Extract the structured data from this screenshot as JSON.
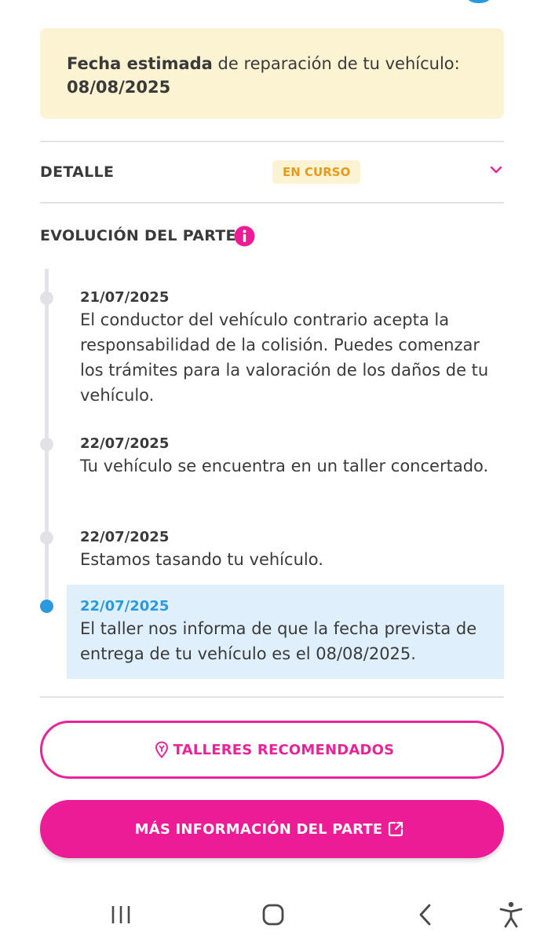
{
  "estimate": {
    "bold_label": "Fecha estimada",
    "label_rest": " de reparación de tu vehículo:",
    "date": "08/08/2025"
  },
  "detail": {
    "label": "DETALLE",
    "status": "EN CURSO"
  },
  "evolution": {
    "title": "EVOLUCIÓN DEL PARTE",
    "events": [
      {
        "date": "21/07/2025",
        "text": "El conductor del vehículo contrario acepta la responsabilidad de la colisión. Puedes comenzar los trámites para la valoración de los daños de tu vehículo."
      },
      {
        "date": "22/07/2025",
        "text": "Tu vehículo se encuentra en un taller concertado."
      },
      {
        "date": "22/07/2025",
        "text": "Estamos tasando tu vehículo."
      },
      {
        "date": "22/07/2025",
        "text": "El taller nos informa de que la fecha prevista de entrega de tu vehículo es el 08/08/2025.",
        "active": true
      }
    ]
  },
  "buttons": {
    "recommended": "TALLERES RECOMENDADOS",
    "more_info": "MÁS INFORMACIÓN DEL PARTE"
  },
  "colors": {
    "accent_pink": "#ec1b96",
    "active_blue": "#2a9ae0",
    "status_orange": "#e89a1c",
    "notice_bg": "#fcf3d3"
  },
  "icons": {
    "chevron": "chevron-down-icon",
    "info": "info-icon",
    "workshop": "location-pin-icon",
    "external": "external-link-icon",
    "nav": [
      "recent-apps-icon",
      "home-icon",
      "back-icon",
      "accessibility-icon"
    ]
  }
}
